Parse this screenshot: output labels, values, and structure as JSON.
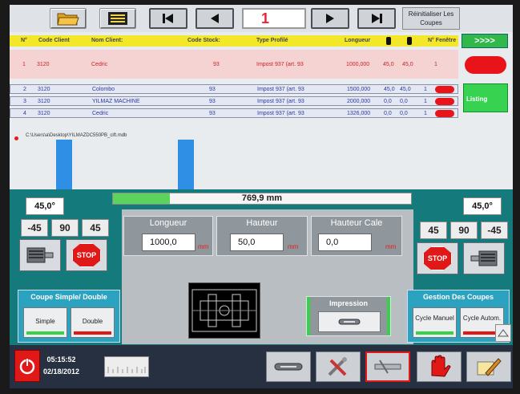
{
  "toolbar": {
    "page_number": "1",
    "reinit_label_line1": "Réinitialiser Les",
    "reinit_label_line2": "Coupes",
    "next_label": ">>>>"
  },
  "table": {
    "headers": {
      "num": "N°",
      "code_client": "Code Client",
      "nom_client": "Nom Client:",
      "code_stock": "Code Stock:",
      "type_profile": "Type Profilé",
      "longueur": "Longueur",
      "no_fenetre": "N° Fenêtre"
    },
    "selected_row": {
      "num": "1",
      "code": "3120",
      "nom": "Cedric",
      "stock": "93",
      "type": "Impost 937 (art. 93",
      "longueur": "1000,000",
      "a1": "45,0",
      "a2": "45,0",
      "fen": "1"
    },
    "rows": [
      {
        "num": "2",
        "code": "3120",
        "nom": "Colombo",
        "stock": "93",
        "type": "Impost 937 (art. 93",
        "longueur": "1500,000",
        "a1": "45,0",
        "a2": "45,0",
        "fen": "1"
      },
      {
        "num": "3",
        "code": "3120",
        "nom": "YILMAZ MACHINE",
        "stock": "93",
        "type": "Impost 937 (art. 93",
        "longueur": "2000,000",
        "a1": "0,0",
        "a2": "0,0",
        "fen": "1"
      },
      {
        "num": "4",
        "code": "3120",
        "nom": "Cedric",
        "stock": "93",
        "type": "Impost 937 (art. 93",
        "longueur": "1326,000",
        "a1": "0,0",
        "a2": "0,0",
        "fen": "1"
      }
    ],
    "listing_label": "Listing"
  },
  "file_path": "C:\\Users\\a\\Desktop\\YILMAZDC550PB_cift.mdb",
  "left": {
    "angle": "45,0°",
    "buttons": [
      "-45",
      "90",
      "45"
    ],
    "stop_label": "STOP"
  },
  "right": {
    "angle": "45,0°",
    "buttons": [
      "45",
      "90",
      "-45"
    ],
    "stop_label": "STOP"
  },
  "progress": {
    "value_text": "769,9 mm",
    "fill_fraction": 0.19
  },
  "fields": {
    "longueur": {
      "title": "Longueur",
      "value": "1000,0",
      "unit": "mm"
    },
    "hauteur": {
      "title": "Hauteur",
      "value": "50,0",
      "unit": "mm"
    },
    "hauteur_cale": {
      "title": "Hauteur Cale",
      "value": "0,0",
      "unit": "mm"
    }
  },
  "impression_label": "Impression",
  "coupe": {
    "title": "Coupe Simple/ Double",
    "simple": "Simple",
    "double": "Double"
  },
  "gestion": {
    "title": "Gestion Des Coupes",
    "manuel": "Cycle Manuel",
    "auto": "Cycle Autom."
  },
  "clock": {
    "time": "05:15:52",
    "date": "02/18/2012"
  },
  "colors": {
    "header_yellow": "#f2e829",
    "teal_panel": "#147a7c",
    "stop_red": "#e01818",
    "listing_green": "#36d250"
  }
}
